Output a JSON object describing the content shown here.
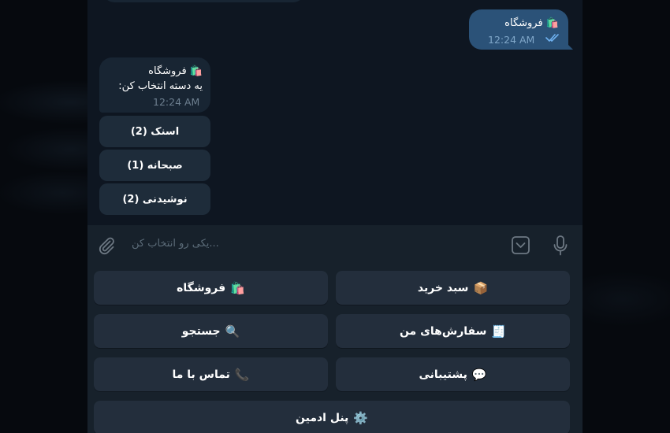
{
  "outgoing": {
    "text": "🛍️ فروشگاه",
    "time": "12:24 AM"
  },
  "incoming": {
    "title": "🛍️ فروشگاه",
    "subtitle": "یه دسته انتخاب کن:",
    "time": "12:24 AM"
  },
  "inline_buttons": [
    {
      "label": "اسنک (2)"
    },
    {
      "label": "صبحانه (1)"
    },
    {
      "label": "نوشیدنی (2)"
    }
  ],
  "composer": {
    "placeholder": "...یکی رو انتخاب کن"
  },
  "keyboard": {
    "store": {
      "icon": "🛍️",
      "label": "فروشگاه"
    },
    "cart": {
      "icon": "📦",
      "label": "سبد خرید"
    },
    "search": {
      "icon": "🔍",
      "label": "جستجو"
    },
    "orders": {
      "icon": "🧾",
      "label": "سفارش‌های من"
    },
    "contact": {
      "icon": "📞",
      "label": "تماس با ما"
    },
    "support": {
      "icon": "💬",
      "label": "پشتیبانی"
    },
    "admin": {
      "icon": "⚙️",
      "label": "پنل ادمین"
    }
  },
  "colors": {
    "chat_bg": "#0e1621",
    "outgoing_bubble": "#2b5278",
    "incoming_bubble": "#182533",
    "panel": "#17212b",
    "keyboard_button": "#232e3c"
  }
}
